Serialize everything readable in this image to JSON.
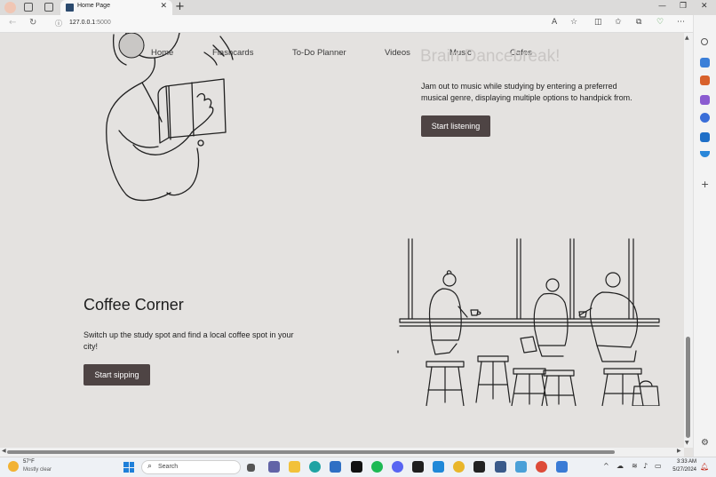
{
  "browser": {
    "tab_title": "Home Page",
    "tab_close": "✕",
    "new_tab": "+",
    "url_host": "127.0.0.1",
    "url_port": ":5000",
    "minimize": "—",
    "restore": "❐",
    "close": "✕"
  },
  "page": {
    "nav": [
      "Home",
      "Flashcards",
      "To-Do Planner",
      "Videos",
      "Music",
      "Cafes"
    ],
    "music_section": {
      "title": "Brain Dancebreak!",
      "text_line1": "Jam out to music while studying by entering a preferred",
      "text_line2": "musical genre, displaying multiple options to handpick from.",
      "button": "Start listening"
    },
    "coffee_section": {
      "title": "Coffee Corner",
      "text_line1": "Switch up the study spot and find a local coffee spot in your",
      "text_line2": "city!",
      "button": "Start sipping"
    }
  },
  "taskbar": {
    "weather_temp": "57°F",
    "weather_desc": "Mostly clear",
    "search_label": "Search",
    "time": "3:33 AM",
    "date": "5/27/2024"
  },
  "colors": {
    "page_bg": "#e4e2e0",
    "button_bg": "#4e4444",
    "accent": "#1e7fd9"
  }
}
